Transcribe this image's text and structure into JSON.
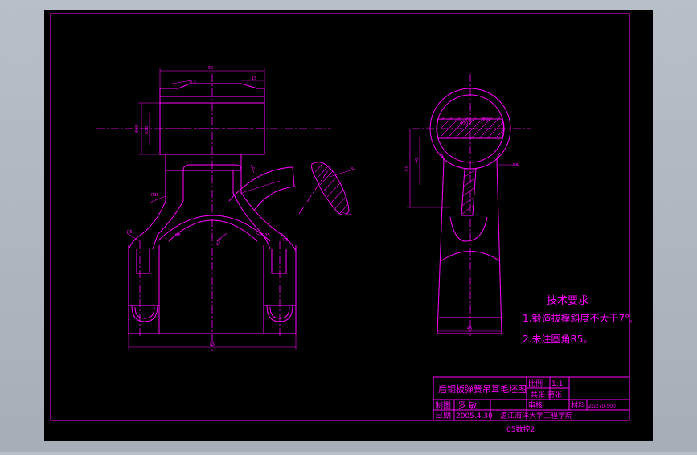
{
  "drawing": {
    "background": "#000000",
    "line_color": "#ff00ff",
    "tech_requirements": {
      "heading": "技术要求",
      "item1": "1.锻造拔模斜度不大于7°,",
      "item2": "2.未注圆角R5。"
    },
    "title_block": {
      "part_name": "后钢板弹簧吊耳毛坯图",
      "scale_label": "比例",
      "scale_value": "1:1",
      "sheet_label": "共张 第张",
      "drawn_label": "制图",
      "drawn_name": "罗  敏",
      "checked_label": "审核",
      "material_label": "材料",
      "material_value": "ZG270-500",
      "date_label": "日期",
      "date_value": "2005.4.30",
      "school": "湛江海洋大学工程学院",
      "class_label": "05数控2"
    },
    "dims": {
      "d_top_width": "60",
      "d_rough": "6.3",
      "d_slot": "15",
      "d_h1": "Φ35",
      "d_h2": "Φ38",
      "d_r1": "R35",
      "d_r2": "R5",
      "d_r3": "R8",
      "d_r4": "R20",
      "d_c1": "R35",
      "d_c2": "R5",
      "d_bottom": "65",
      "d_side_r": "Φ30",
      "d_side_h": "57",
      "d_side_w": "40",
      "d_side_b": "46",
      "d_side_d": "Φ36",
      "d_side_r2": "R8",
      "d_angle": "7°",
      "d_sect": "8"
    }
  }
}
